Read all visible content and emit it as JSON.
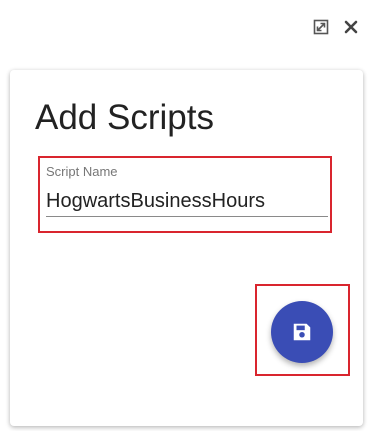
{
  "dialog": {
    "title": "Add Scripts",
    "icons": {
      "expand": "expand-icon",
      "close": "close-icon"
    }
  },
  "form": {
    "script_name_label": "Script Name",
    "script_name_value": "HogwartsBusinessHours"
  },
  "actions": {
    "save_icon": "floppy-disk-icon"
  },
  "colors": {
    "accent": "#3a4db5",
    "highlight": "#d9252e"
  }
}
